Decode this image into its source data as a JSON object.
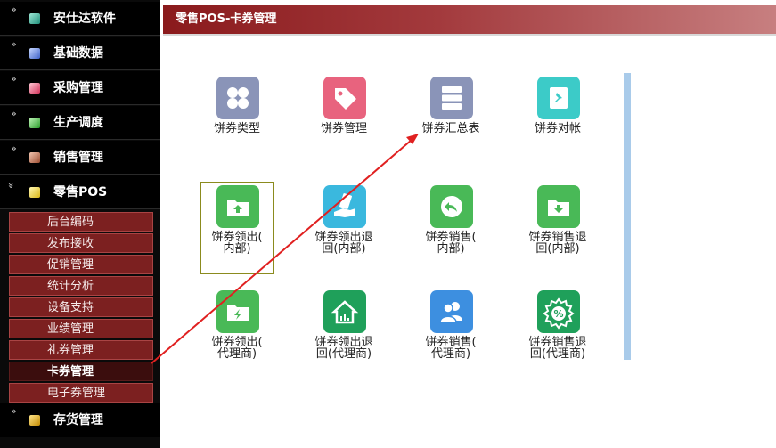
{
  "colors": {
    "sidebar_bg": "#0a0a0a",
    "submenu_bg": "#7c2020",
    "submenu_active_bg": "#3b0d0d",
    "header_start": "#8a1a1c",
    "header_end": "#c77f80",
    "arrow": "#e02020",
    "scrollbar": "#a9cbea"
  },
  "sidebar": {
    "groups": [
      {
        "label": "安仕达软件",
        "icon": "teal-cube-icon"
      },
      {
        "label": "基础数据",
        "icon": "blue-cube-icon"
      },
      {
        "label": "采购管理",
        "icon": "pink-cube-icon"
      },
      {
        "label": "生产调度",
        "icon": "green-cube-icon"
      },
      {
        "label": "销售管理",
        "icon": "brown-cube-icon"
      },
      {
        "label": "零售POS",
        "icon": "yellow-cube-icon"
      },
      {
        "label": "存货管理",
        "icon": "gold-cube-icon"
      }
    ],
    "submenu": [
      {
        "label": "后台编码"
      },
      {
        "label": "发布接收"
      },
      {
        "label": "促销管理"
      },
      {
        "label": "统计分析"
      },
      {
        "label": "设备支持"
      },
      {
        "label": "业绩管理"
      },
      {
        "label": "礼券管理"
      },
      {
        "label": "卡券管理",
        "active": true
      },
      {
        "label": "电子券管理"
      }
    ],
    "expand_glyph": "»",
    "collapse_glyph": "»"
  },
  "header": {
    "title": "零售POS-卡券管理"
  },
  "tiles": [
    {
      "label": "饼券类型",
      "icon": "four-petal-grid-icon",
      "color": "#8a94b8"
    },
    {
      "label": "饼券管理",
      "icon": "price-tag-icon",
      "color": "#e8637e"
    },
    {
      "label": "饼券汇总表",
      "icon": "server-list-icon",
      "color": "#8a94b8"
    },
    {
      "label": "饼券对帐",
      "icon": "pin-note-icon",
      "color": "#3ccbc8"
    },
    {
      "label": "饼券领出(\n内部)",
      "icon": "folder-upload-icon",
      "color": "#49b957"
    },
    {
      "label": "饼券领出退\n回(内部)",
      "icon": "ticket-hand-icon",
      "color": "#3ab8de"
    },
    {
      "label": "饼券销售(\n内部)",
      "icon": "undo-arrow-icon",
      "color": "#49b957"
    },
    {
      "label": "饼券销售退\n回(内部)",
      "icon": "folder-download-icon",
      "color": "#49b957"
    },
    {
      "label": "饼券领出(\n代理商)",
      "icon": "folder-lightning-icon",
      "color": "#49b957"
    },
    {
      "label": "饼券领出退\n回(代理商)",
      "icon": "house-chart-icon",
      "color": "#1fa05a"
    },
    {
      "label": "饼券销售(\n代理商)",
      "icon": "users-icon",
      "color": "#3d8fe0"
    },
    {
      "label": "饼券销售退\n回(代理商)",
      "icon": "percent-badge-icon",
      "color": "#1fa05a"
    }
  ]
}
